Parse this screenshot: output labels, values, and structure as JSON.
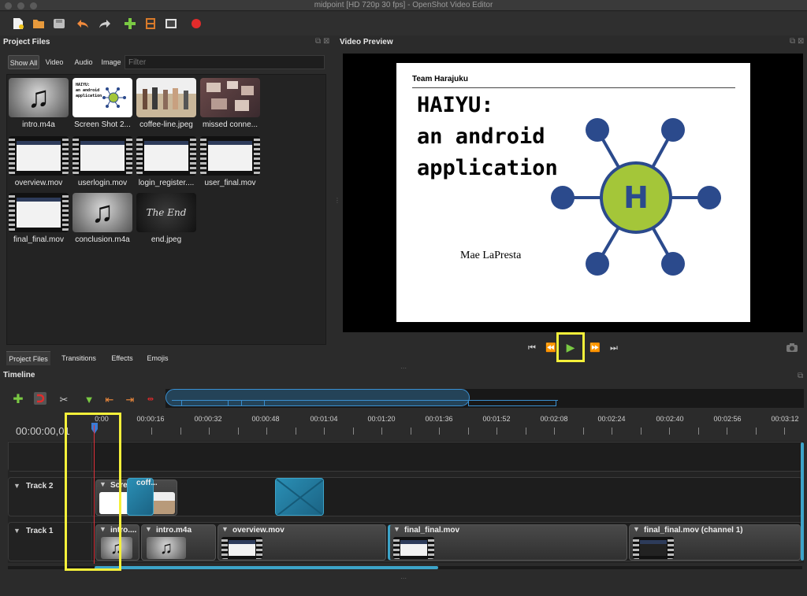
{
  "window": {
    "title": "midpoint [HD 720p 30 fps] - OpenShot Video Editor"
  },
  "toolbar": {
    "icons": [
      "new-project-icon",
      "open-project-icon",
      "save-project-icon",
      "undo-icon",
      "redo-icon",
      "import-files-icon",
      "choose-profile-icon",
      "fullscreen-icon",
      "export-video-icon"
    ]
  },
  "project_files": {
    "header": "Project Files",
    "filter_tabs": [
      "Show All",
      "Video",
      "Audio",
      "Image"
    ],
    "filter_placeholder": "Filter",
    "files": [
      {
        "name": "intro.m4a",
        "kind": "audio"
      },
      {
        "name": "Screen Shot 2...",
        "kind": "slide"
      },
      {
        "name": "coffee-line.jpeg",
        "kind": "photo"
      },
      {
        "name": "missed conne...",
        "kind": "photo2"
      },
      {
        "name": "overview.mov",
        "kind": "video"
      },
      {
        "name": "userlogin.mov",
        "kind": "video"
      },
      {
        "name": "login_register....",
        "kind": "video"
      },
      {
        "name": "user_final.mov",
        "kind": "video"
      },
      {
        "name": "final_final.mov",
        "kind": "video"
      },
      {
        "name": "conclusion.m4a",
        "kind": "audio"
      },
      {
        "name": "end.jpeg",
        "kind": "end"
      }
    ],
    "end_thumb_text": "The End",
    "slide_thumb_text": "HAIYU: an android application"
  },
  "left_tabs": [
    "Project Files",
    "Transitions",
    "Effects",
    "Emojis"
  ],
  "video_preview": {
    "header": "Video Preview",
    "slide": {
      "team": "Team Harajuku",
      "lines": [
        "HAIYU:",
        "an android",
        "application"
      ],
      "logo_letter": "H",
      "author": "Mae LaPresta"
    },
    "transport": [
      "⏮",
      "⏪",
      "▶",
      "⏩",
      "⏭"
    ]
  },
  "timeline": {
    "header": "Timeline",
    "timecode": "00:00:00,01",
    "ruler": [
      "0:00",
      "00:00:16",
      "00:00:32",
      "00:00:48",
      "00:01:04",
      "00:01:20",
      "00:01:36",
      "00:01:52",
      "00:02:08",
      "00:02:24",
      "00:02:40",
      "00:02:56",
      "00:03:12"
    ],
    "tracks": [
      {
        "name": "Track 2",
        "clips": [
          "Scre...",
          "coff..."
        ]
      },
      {
        "name": "Track 1",
        "clips": [
          "intro....",
          "intro.m4a",
          "overview.mov",
          "final_final.mov",
          "final_final.mov (channel 1)"
        ]
      }
    ]
  },
  "colors": {
    "highlight": "#f5f03a",
    "accent": "#3ca4c9",
    "playhead": "#e0303a",
    "logo_green": "#a4c639",
    "logo_navy": "#2b4a8c"
  }
}
